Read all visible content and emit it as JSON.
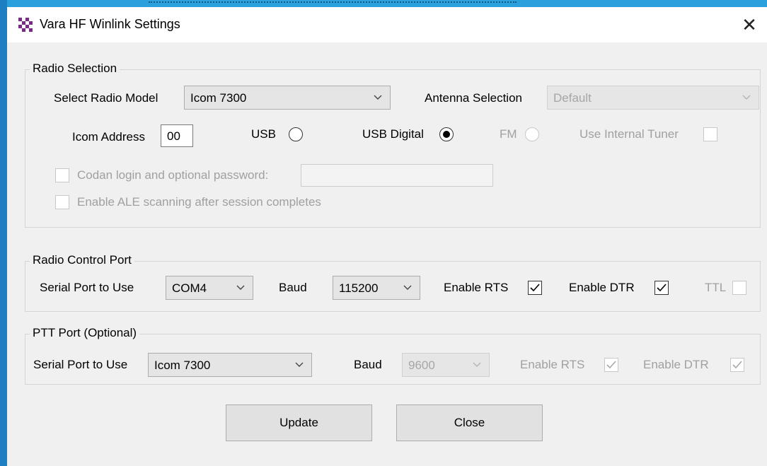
{
  "window": {
    "title": "Vara HF Winlink Settings",
    "close_glyph": "✕"
  },
  "radio_selection": {
    "legend": "Radio Selection",
    "model_label": "Select Radio Model",
    "model_value": "Icom 7300",
    "antenna_label": "Antenna Selection",
    "antenna_value": "Default",
    "icom_address_label": "Icom Address",
    "icom_address_value": "00",
    "usb_label": "USB",
    "usb_digital_label": "USB Digital",
    "fm_label": "FM",
    "internal_tuner_label": "Use Internal Tuner",
    "codan_label": "Codan login and optional password:",
    "codan_value": "",
    "ale_label": "Enable ALE scanning after session completes",
    "mode_selected": "USB Digital"
  },
  "radio_control_port": {
    "legend": "Radio Control Port",
    "serial_label": "Serial Port to Use",
    "serial_value": "COM4",
    "baud_label": "Baud",
    "baud_value": "115200",
    "rts_label": "Enable RTS",
    "rts_checked": true,
    "dtr_label": "Enable DTR",
    "dtr_checked": true,
    "ttl_label": "TTL",
    "ttl_checked": false
  },
  "ptt_port": {
    "legend": "PTT Port (Optional)",
    "serial_label": "Serial Port to Use",
    "serial_value": "Icom 7300",
    "baud_label": "Baud",
    "baud_value": "9600",
    "rts_label": "Enable RTS",
    "rts_checked": true,
    "dtr_label": "Enable DTR",
    "dtr_checked": true
  },
  "buttons": {
    "update": "Update",
    "close": "Close"
  },
  "icons": {
    "app": "vara-app-icon",
    "dropdown": "chevron-down-icon",
    "check": "checkmark-icon",
    "close": "close-icon"
  },
  "colors": {
    "desktop": "#1f8fd0",
    "app_icon": "#7a2b86",
    "dialog_bg": "#f0f0f0"
  }
}
